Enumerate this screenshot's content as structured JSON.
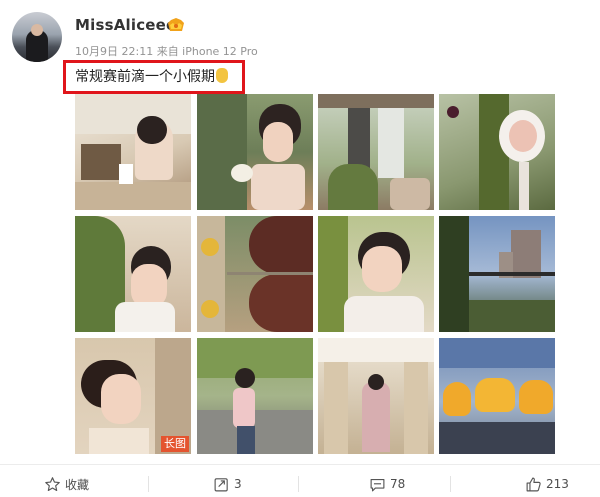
{
  "post": {
    "username": "MissAliceee",
    "meta": "10月9日 22:11 来自 iPhone 12 Pro",
    "text": "常规赛前滴一个小假期",
    "long_image_badge": "长图"
  },
  "actions": {
    "favorite_label": "收藏",
    "repost_count": "3",
    "comment_count": "78",
    "like_count": "213"
  },
  "colors": {
    "highlight_border": "#e0151b",
    "badge": "#e4542f"
  }
}
